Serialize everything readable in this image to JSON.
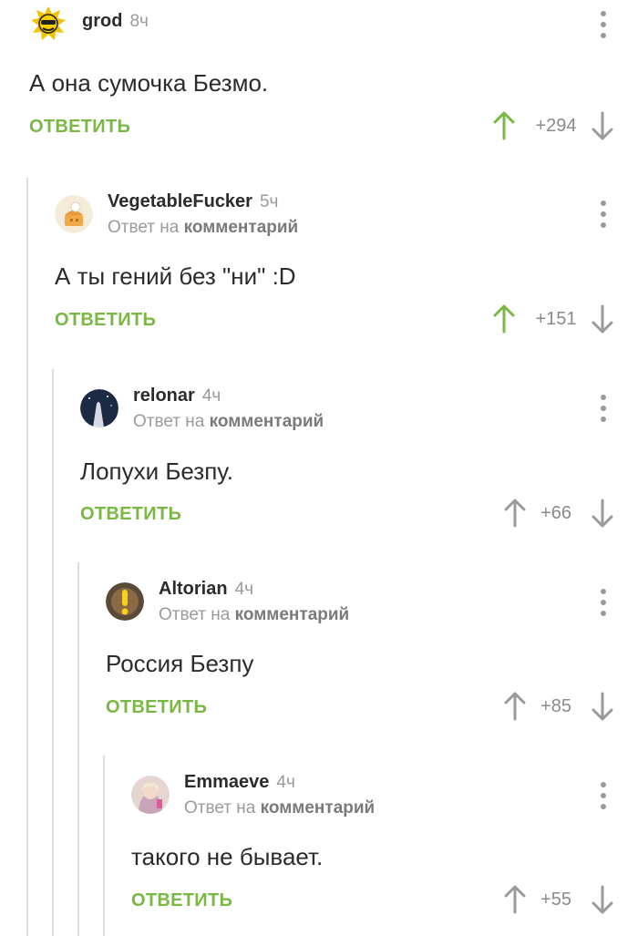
{
  "comments": [
    {
      "author": "grod",
      "time": "8ч",
      "reply_to": "",
      "text": "А она сумочка Безмо.",
      "reply_label": "ОТВЕТИТЬ",
      "score": "+294",
      "upvoted": true
    },
    {
      "author": "VegetableFucker",
      "time": "5ч",
      "reply_prefix": "Ответ на",
      "reply_target": "комментарий",
      "text": "А ты гений без \"ни\" :D",
      "reply_label": "ОТВЕТИТЬ",
      "score": "+151",
      "upvoted": true
    },
    {
      "author": "relonar",
      "time": "4ч",
      "reply_prefix": "Ответ на",
      "reply_target": "комментарий",
      "text": "Лопухи Безпу.",
      "reply_label": "ОТВЕТИТЬ",
      "score": "+66",
      "upvoted": false
    },
    {
      "author": "Altorian",
      "time": "4ч",
      "reply_prefix": "Ответ на",
      "reply_target": "комментарий",
      "text": "Россия Безпу",
      "reply_label": "ОТВЕТИТЬ",
      "score": "+85",
      "upvoted": false
    },
    {
      "author": "Emmaeve",
      "time": "4ч",
      "reply_prefix": "Ответ на",
      "reply_target": "комментарий",
      "text": "такого не бывает.",
      "reply_label": "ОТВЕТИТЬ",
      "score": "+55",
      "upvoted": false
    }
  ],
  "colors": {
    "accent_green": "#79b843",
    "muted": "#9a9a9a",
    "thread_line": "#dcdcdc"
  }
}
